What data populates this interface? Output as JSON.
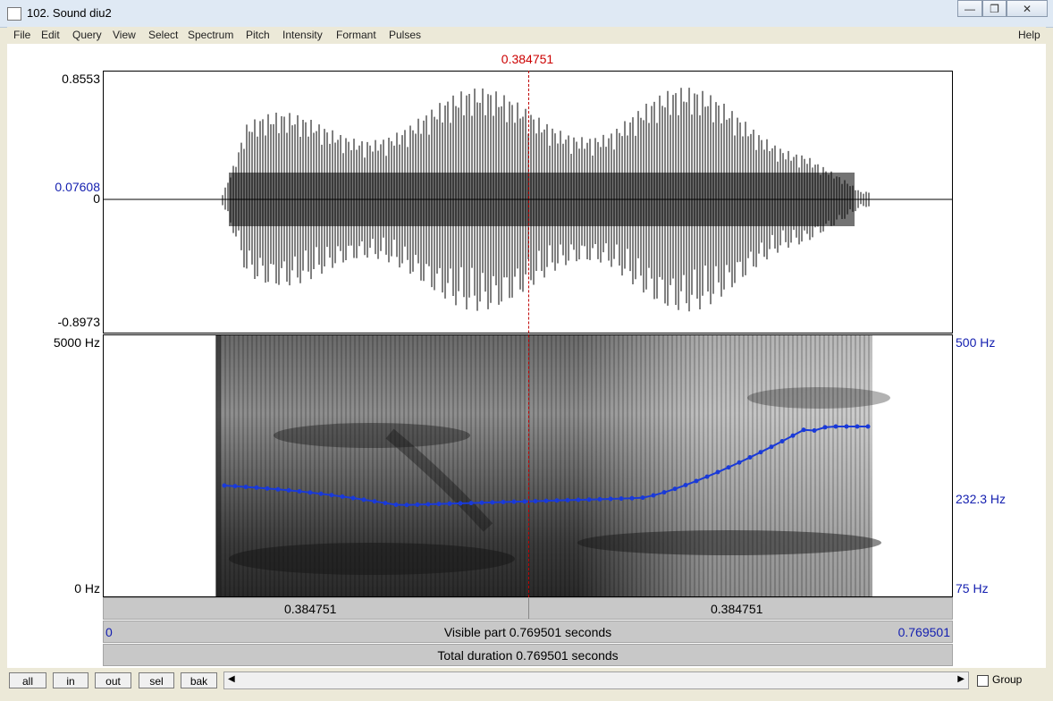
{
  "window": {
    "title": "102. Sound diu2",
    "controls": [
      "minimize",
      "maximize",
      "close"
    ],
    "close_glyph": "✕",
    "max_glyph": "❐",
    "min_glyph": "—"
  },
  "menu": {
    "items": [
      "File",
      "Edit",
      "Query",
      "View",
      "Select",
      "Spectrum",
      "Pitch",
      "Intensity",
      "Formant",
      "Pulses"
    ],
    "help": "Help"
  },
  "cursor": {
    "time_label": "0.384751",
    "color": "#cc0000"
  },
  "waveform": {
    "y_max": "0.8553",
    "y_cursor_value": "0.07608",
    "y_zero": "0",
    "y_min": "-0.8973"
  },
  "spectrogram": {
    "freq_top": "5000 Hz",
    "freq_bottom": "0 Hz"
  },
  "pitch": {
    "top": "500 Hz",
    "cursor_value": "232.3 Hz",
    "bottom": "75 Hz",
    "color": "#1a3ad8"
  },
  "bars": {
    "left_part": "0.384751",
    "right_part": "0.384751",
    "visible_start": "0",
    "visible_text": "Visible part 0.769501 seconds",
    "visible_end": "0.769501",
    "total_text": "Total duration 0.769501 seconds"
  },
  "buttons": {
    "all": "all",
    "in": "in",
    "out": "out",
    "sel": "sel",
    "bak": "bak"
  },
  "scroll": {
    "left_arrow": "◀",
    "right_arrow": "▶"
  },
  "group": {
    "label": "Group",
    "checked": false
  }
}
